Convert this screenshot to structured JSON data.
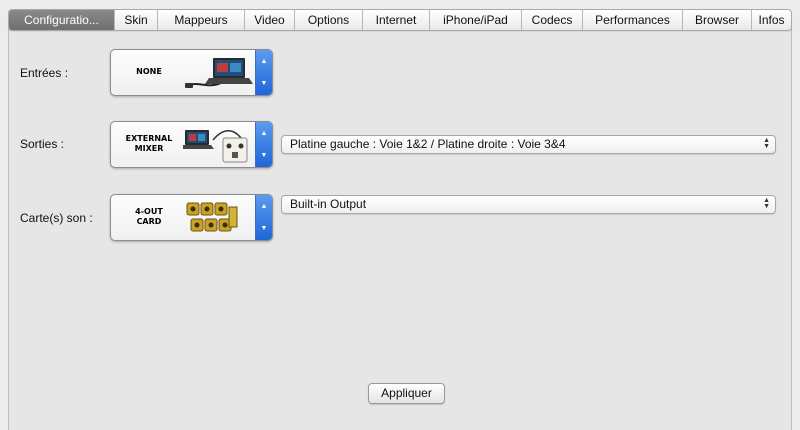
{
  "tabs": [
    {
      "label": "Configuratio...",
      "active": true
    },
    {
      "label": "Skin"
    },
    {
      "label": "Mappeurs"
    },
    {
      "label": "Video"
    },
    {
      "label": "Options"
    },
    {
      "label": "Internet"
    },
    {
      "label": "iPhone/iPad"
    },
    {
      "label": "Codecs"
    },
    {
      "label": "Performances"
    },
    {
      "label": "Browser"
    },
    {
      "label": "Infos"
    }
  ],
  "inputs": {
    "label": "Entrées :",
    "device_text": "NONE",
    "icon": "laptop-with-cable-icon"
  },
  "outputs": {
    "label": "Sorties :",
    "device_text_line1": "EXTERNAL",
    "device_text_line2": "MIXER",
    "icon": "laptop-and-mixer-icon",
    "routing_value": "Platine gauche : Voie 1&2 / Platine droite : Voie 3&4"
  },
  "soundcard": {
    "label": "Carte(s) son :",
    "device_text_line1": "4-OUT",
    "device_text_line2": "CARD",
    "icon": "rca-connectors-icon",
    "device_value": "Built-in Output"
  },
  "apply_label": "Appliquer",
  "colors": {
    "active_tab": "#7c7c7c",
    "stepper_blue": "#2f74e0",
    "background": "#ececec"
  }
}
